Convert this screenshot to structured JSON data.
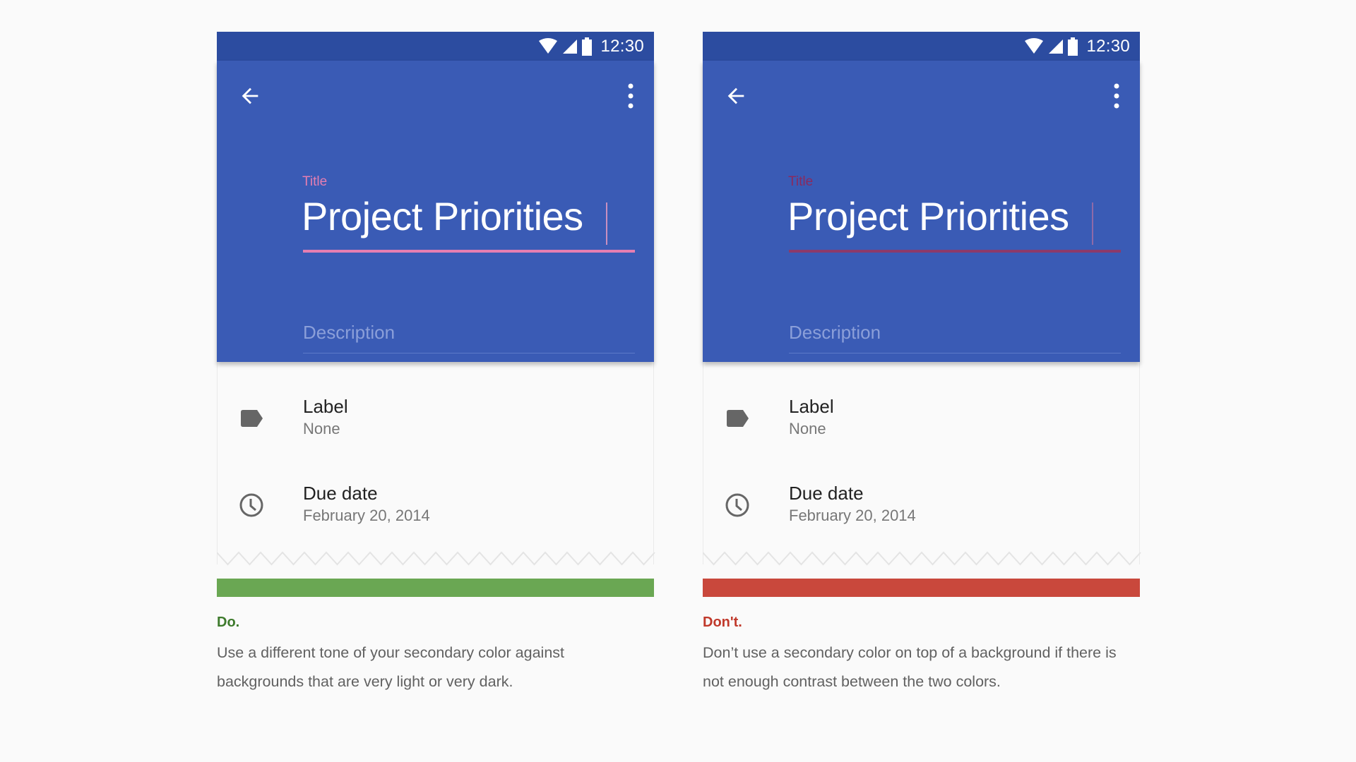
{
  "colors": {
    "page_bg": "#fafafa",
    "status_bar": "#2c4ca0",
    "app_bar": "#3a5bb5",
    "do_green": "#6aa753",
    "do_text": "#3d7a2c",
    "dont_red": "#c9483c",
    "dont_text": "#c0392b"
  },
  "examples": [
    {
      "id": "do",
      "status_bar": {
        "icons": [
          "wifi-icon",
          "signal-icon",
          "battery-icon"
        ],
        "time": "12:30"
      },
      "app_bar": {
        "back_icon": "arrow-back-icon",
        "menu_icon": "more-vert-icon"
      },
      "title_field": {
        "label": "Title",
        "value": "Project Priorities",
        "accent_color": "#e57eb1",
        "underline_color": "#e57eb1"
      },
      "description_field": {
        "placeholder": "Description"
      },
      "rows": [
        {
          "icon": "label-icon",
          "primary": "Label",
          "secondary": "None"
        },
        {
          "icon": "clock-icon",
          "primary": "Due date",
          "secondary": "February 20, 2014"
        }
      ],
      "verdict": "Do.",
      "caption": "Use a different tone of your secondary color against backgrounds that are very light or very dark."
    },
    {
      "id": "dont",
      "status_bar": {
        "icons": [
          "wifi-icon",
          "signal-icon",
          "battery-icon"
        ],
        "time": "12:30"
      },
      "app_bar": {
        "back_icon": "arrow-back-icon",
        "menu_icon": "more-vert-icon"
      },
      "title_field": {
        "label": "Title",
        "value": "Project Priorities",
        "accent_color": "#8a2a5e",
        "underline_color": "#8c3a6a"
      },
      "description_field": {
        "placeholder": "Description"
      },
      "rows": [
        {
          "icon": "label-icon",
          "primary": "Label",
          "secondary": "None"
        },
        {
          "icon": "clock-icon",
          "primary": "Due date",
          "secondary": "February 20, 2014"
        }
      ],
      "verdict": "Don't.",
      "caption": "Don’t use a secondary color on top of a background if there is not enough contrast between the two colors."
    }
  ]
}
